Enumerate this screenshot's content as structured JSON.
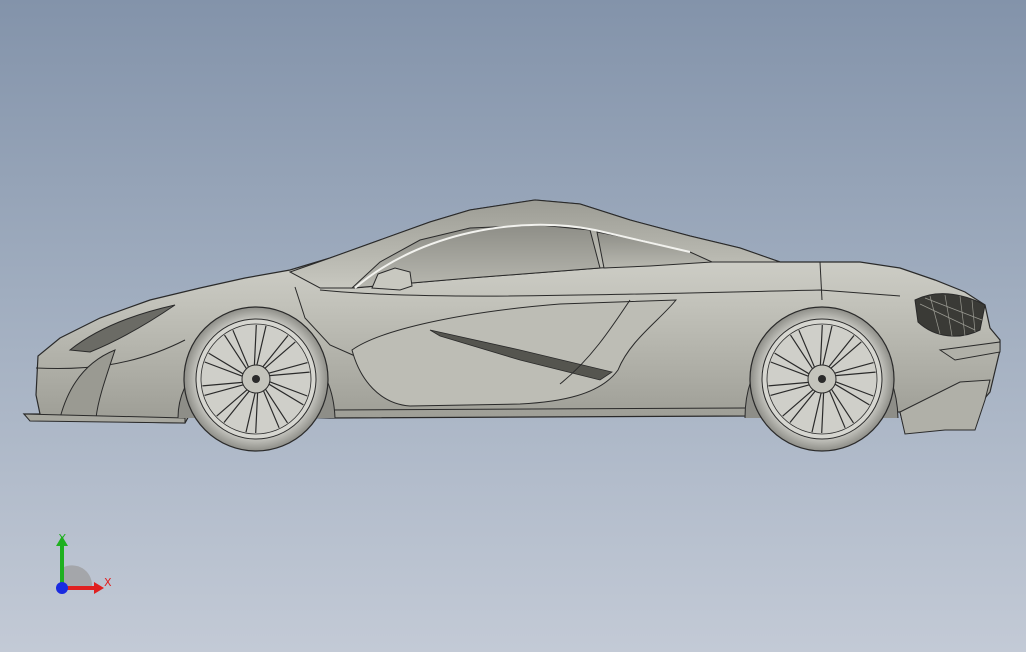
{
  "viewport": {
    "background_top": "#8393aa",
    "background_bottom": "#c3cad6",
    "model_color": "#c9c9c2",
    "edge_color": "#2a2a2a"
  },
  "triad": {
    "x_label": "X",
    "y_label": "Y",
    "x_color": "#e02020",
    "y_color": "#1fb01f",
    "z_color": "#1a2be0"
  }
}
